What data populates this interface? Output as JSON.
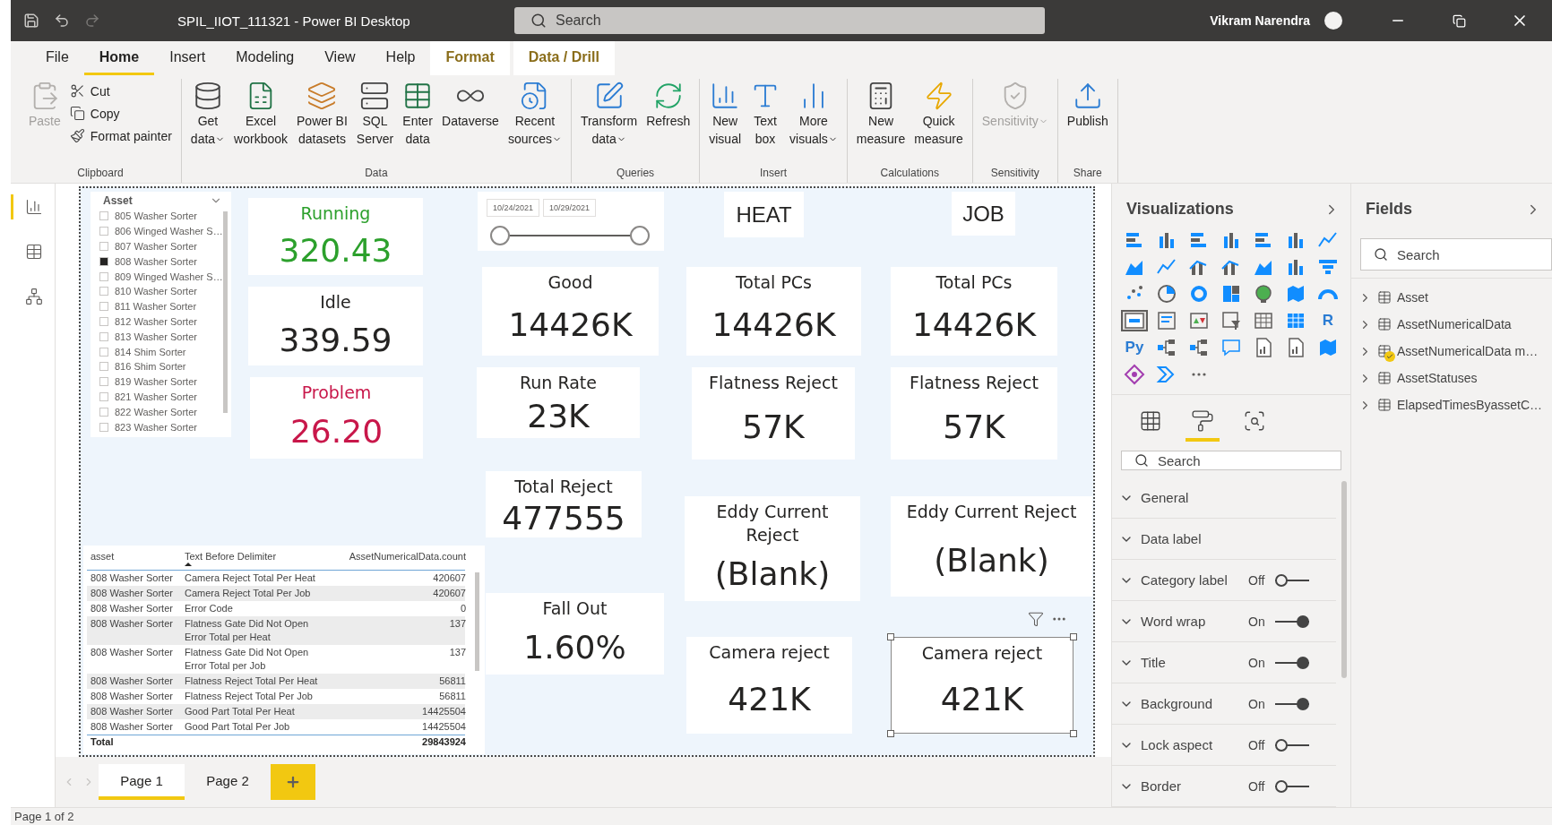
{
  "window": {
    "title": "SPIL_IIOT_111321 - Power BI Desktop",
    "search_placeholder": "Search",
    "user": "Vikram Narendra"
  },
  "menu_tabs": [
    {
      "label": "File",
      "selected": false,
      "kind": "normal"
    },
    {
      "label": "Home",
      "selected": true,
      "kind": "normal"
    },
    {
      "label": "Insert",
      "selected": false,
      "kind": "normal"
    },
    {
      "label": "Modeling",
      "selected": false,
      "kind": "normal"
    },
    {
      "label": "View",
      "selected": false,
      "kind": "normal"
    },
    {
      "label": "Help",
      "selected": false,
      "kind": "normal"
    },
    {
      "label": "Format",
      "selected": false,
      "kind": "contextual"
    },
    {
      "label": "Data / Drill",
      "selected": false,
      "kind": "contextual"
    }
  ],
  "ribbon": [
    {
      "name": "Clipboard",
      "buttons": [
        {
          "lines": [
            "Paste"
          ],
          "kind": "large",
          "disabled": true,
          "dropdown": false
        },
        {
          "lines": [
            "Cut"
          ],
          "kind": "small",
          "disabled": false,
          "dropdown": false
        },
        {
          "lines": [
            "Copy"
          ],
          "kind": "small",
          "disabled": false,
          "dropdown": false
        },
        {
          "lines": [
            "Format painter"
          ],
          "kind": "small",
          "disabled": false,
          "dropdown": false
        }
      ]
    },
    {
      "name": "Data",
      "buttons": [
        {
          "lines": [
            "Get",
            "data"
          ],
          "kind": "large",
          "disabled": false,
          "dropdown": true
        },
        {
          "lines": [
            "Excel",
            "workbook"
          ],
          "kind": "large",
          "disabled": false,
          "dropdown": false
        },
        {
          "lines": [
            "Power BI",
            "datasets"
          ],
          "kind": "large",
          "disabled": false,
          "dropdown": false
        },
        {
          "lines": [
            "SQL",
            "Server"
          ],
          "kind": "large",
          "disabled": false,
          "dropdown": false
        },
        {
          "lines": [
            "Enter",
            "data"
          ],
          "kind": "large",
          "disabled": false,
          "dropdown": false
        },
        {
          "lines": [
            "Dataverse"
          ],
          "kind": "large",
          "disabled": false,
          "dropdown": false
        },
        {
          "lines": [
            "Recent",
            "sources"
          ],
          "kind": "large",
          "disabled": false,
          "dropdown": true
        }
      ]
    },
    {
      "name": "Queries",
      "buttons": [
        {
          "lines": [
            "Transform",
            "data"
          ],
          "kind": "large",
          "disabled": false,
          "dropdown": true
        },
        {
          "lines": [
            "Refresh"
          ],
          "kind": "large",
          "disabled": false,
          "dropdown": false
        }
      ]
    },
    {
      "name": "Insert",
      "buttons": [
        {
          "lines": [
            "New",
            "visual"
          ],
          "kind": "large",
          "disabled": false,
          "dropdown": false
        },
        {
          "lines": [
            "Text",
            "box"
          ],
          "kind": "large",
          "disabled": false,
          "dropdown": false
        },
        {
          "lines": [
            "More",
            "visuals"
          ],
          "kind": "large",
          "disabled": false,
          "dropdown": true
        }
      ]
    },
    {
      "name": "Calculations",
      "buttons": [
        {
          "lines": [
            "New",
            "measure"
          ],
          "kind": "large",
          "disabled": false,
          "dropdown": false
        },
        {
          "lines": [
            "Quick",
            "measure"
          ],
          "kind": "large",
          "disabled": false,
          "dropdown": false
        }
      ]
    },
    {
      "name": "Sensitivity",
      "buttons": [
        {
          "lines": [
            "Sensitivity"
          ],
          "kind": "large",
          "disabled": true,
          "dropdown": true
        }
      ]
    },
    {
      "name": "Share",
      "buttons": [
        {
          "lines": [
            "Publish"
          ],
          "kind": "large",
          "disabled": false,
          "dropdown": false
        }
      ]
    }
  ],
  "nav": [
    {
      "selected": true
    },
    {
      "selected": false
    },
    {
      "selected": false
    }
  ],
  "visuals": [
    {
      "kind": "slicer",
      "title": "Asset",
      "items": [
        {
          "label": "805 Washer Sorter",
          "checked": false
        },
        {
          "label": "806 Winged Washer S…",
          "checked": false
        },
        {
          "label": "807 Washer Sorter",
          "checked": false
        },
        {
          "label": "808 Washer Sorter",
          "checked": true
        },
        {
          "label": "809 Winged Washer S…",
          "checked": false
        },
        {
          "label": "810 Washer Sorter",
          "checked": false
        },
        {
          "label": "811 Washer Sorter",
          "checked": false
        },
        {
          "label": "812 Washer Sorter",
          "checked": false
        },
        {
          "label": "813 Washer Sorter",
          "checked": false
        },
        {
          "label": "814 Shim Sorter",
          "checked": false
        },
        {
          "label": "816 Shim Sorter",
          "checked": false
        },
        {
          "label": "819 Washer Sorter",
          "checked": false
        },
        {
          "label": "821 Washer Sorter",
          "checked": false
        },
        {
          "label": "822 Washer Sorter",
          "checked": false
        },
        {
          "label": "823 Washer Sorter",
          "checked": false
        }
      ]
    },
    {
      "kind": "card",
      "title": "Running",
      "value": "320.43",
      "color": "#2ca02c",
      "selected": false
    },
    {
      "kind": "card",
      "title": "Idle",
      "value": "339.59",
      "color": "#252423",
      "selected": false
    },
    {
      "kind": "card",
      "title": "Problem",
      "value": "26.20",
      "color": "#c8174a",
      "selected": false
    },
    {
      "kind": "date_range",
      "from": "10/24/2021",
      "to": "10/29/2021"
    },
    {
      "kind": "textbox",
      "text": "HEAT"
    },
    {
      "kind": "textbox",
      "text": "JOB"
    },
    {
      "kind": "card",
      "title": "Good",
      "value": "14426K",
      "color": "#252423",
      "selected": false
    },
    {
      "kind": "card",
      "title": "Total PCs",
      "value": "14426K",
      "color": "#252423",
      "selected": false
    },
    {
      "kind": "card",
      "title": "Total PCs",
      "value": "14426K",
      "color": "#252423",
      "selected": false
    },
    {
      "kind": "card",
      "title": "Run Rate",
      "value": "23K",
      "color": "#252423",
      "selected": false
    },
    {
      "kind": "card",
      "title": "Flatness Reject",
      "value": "57K",
      "color": "#252423",
      "selected": false
    },
    {
      "kind": "card",
      "title": "Flatness Reject",
      "value": "57K",
      "color": "#252423",
      "selected": false
    },
    {
      "kind": "card",
      "title": "Total Reject",
      "value": "477555",
      "color": "#252423",
      "selected": false
    },
    {
      "kind": "card",
      "title": "Eddy Current Reject",
      "value": "(Blank)",
      "color": "#252423",
      "selected": false
    },
    {
      "kind": "card",
      "title": "Eddy Current Reject",
      "value": "(Blank)",
      "color": "#252423",
      "selected": false
    },
    {
      "kind": "card",
      "title": "Fall Out",
      "value": "1.60%",
      "color": "#252423",
      "selected": false
    },
    {
      "kind": "card",
      "title": "Camera reject",
      "value": "421K",
      "color": "#252423",
      "selected": false
    },
    {
      "kind": "card",
      "title": "Camera reject",
      "value": "421K",
      "color": "#252423",
      "selected": true
    },
    {
      "kind": "table",
      "columns": [
        {
          "label": "asset",
          "sorted": false
        },
        {
          "label": "Text Before Delimiter",
          "sorted": true
        },
        {
          "label": "AssetNumericalData.count",
          "sorted": false
        }
      ],
      "rows": [
        [
          "808 Washer Sorter",
          "Camera Reject Total Per Heat",
          "420607"
        ],
        [
          "808 Washer Sorter",
          "Camera Reject Total Per Job",
          "420607"
        ],
        [
          "808 Washer Sorter",
          "Error Code",
          "0"
        ],
        [
          "808 Washer Sorter",
          "Flatness Gate Did Not Open Error Total per Heat",
          "137"
        ],
        [
          "808 Washer Sorter",
          "Flatness Gate Did Not Open Error Total per Job",
          "137"
        ],
        [
          "808 Washer Sorter",
          "Flatness Reject Total Per Heat",
          "56811"
        ],
        [
          "808 Washer Sorter",
          "Flatness Reject Total Per Job",
          "56811"
        ],
        [
          "808 Washer Sorter",
          "Good Part Total Per Heat",
          "14425504"
        ],
        [
          "808 Washer Sorter",
          "Good Part Total Per Job",
          "14425504"
        ]
      ],
      "total": {
        "label": "Total",
        "value": "29843924"
      }
    }
  ],
  "pages": [
    {
      "label": "Page 1",
      "selected": true
    },
    {
      "label": "Page 2",
      "selected": false
    }
  ],
  "visualizations": {
    "title": "Visualizations",
    "icons": [
      {
        "kind": "bar",
        "selected": false
      },
      {
        "kind": "column",
        "selected": false
      },
      {
        "kind": "bar",
        "selected": false
      },
      {
        "kind": "column",
        "selected": false
      },
      {
        "kind": "bar",
        "selected": false
      },
      {
        "kind": "column",
        "selected": false
      },
      {
        "kind": "line",
        "selected": false
      },
      {
        "kind": "area",
        "selected": false
      },
      {
        "kind": "line",
        "selected": false
      },
      {
        "kind": "combo",
        "selected": false
      },
      {
        "kind": "combo",
        "selected": false
      },
      {
        "kind": "area",
        "selected": false
      },
      {
        "kind": "column",
        "selected": false
      },
      {
        "kind": "funnel",
        "selected": false
      },
      {
        "kind": "scatter",
        "selected": false
      },
      {
        "kind": "pie",
        "selected": false
      },
      {
        "kind": "donut",
        "selected": false
      },
      {
        "kind": "treemap",
        "selected": false
      },
      {
        "kind": "globe",
        "selected": false
      },
      {
        "kind": "map",
        "selected": false
      },
      {
        "kind": "gauge",
        "selected": false
      },
      {
        "kind": "card",
        "selected": true
      },
      {
        "kind": "list",
        "selected": false
      },
      {
        "kind": "kpi",
        "selected": false
      },
      {
        "kind": "slicer",
        "selected": false
      },
      {
        "kind": "table",
        "selected": false
      },
      {
        "kind": "matrix",
        "selected": false
      },
      {
        "kind": "text",
        "label": "R",
        "selected": false
      },
      {
        "kind": "text",
        "label": "Py",
        "selected": false
      },
      {
        "kind": "tree",
        "selected": false
      },
      {
        "kind": "tree",
        "selected": false
      },
      {
        "kind": "chat",
        "selected": false
      },
      {
        "kind": "doc",
        "selected": false
      },
      {
        "kind": "doc",
        "selected": false
      },
      {
        "kind": "map",
        "selected": false
      },
      {
        "kind": "diamond",
        "selected": false
      },
      {
        "kind": "chevron",
        "selected": false
      },
      {
        "kind": "more",
        "selected": false
      }
    ],
    "pane_tabs": [
      {
        "selected": false
      },
      {
        "selected": true
      },
      {
        "selected": false
      }
    ],
    "search_placeholder": "Search",
    "sections": [
      {
        "label": "General"
      },
      {
        "label": "Data label"
      },
      {
        "label": "Category label",
        "toggle": {
          "text": "Off",
          "on": false
        }
      },
      {
        "label": "Word wrap",
        "toggle": {
          "text": "On",
          "on": true
        }
      },
      {
        "label": "Title",
        "toggle": {
          "text": "On",
          "on": true
        }
      },
      {
        "label": "Background",
        "toggle": {
          "text": "On",
          "on": true
        }
      },
      {
        "label": "Lock aspect",
        "toggle": {
          "text": "Off",
          "on": false
        }
      },
      {
        "label": "Border",
        "toggle": {
          "text": "Off",
          "on": false
        }
      }
    ]
  },
  "fields": {
    "title": "Fields",
    "search_placeholder": "Search",
    "tables": [
      {
        "label": "Asset",
        "checked": false
      },
      {
        "label": "AssetNumericalData",
        "checked": false
      },
      {
        "label": "AssetNumericalData m…",
        "checked": true
      },
      {
        "label": "AssetStatuses",
        "checked": false
      },
      {
        "label": "ElapsedTimesByassetC…",
        "checked": false
      }
    ]
  },
  "status_bar": "Page 1 of 2"
}
